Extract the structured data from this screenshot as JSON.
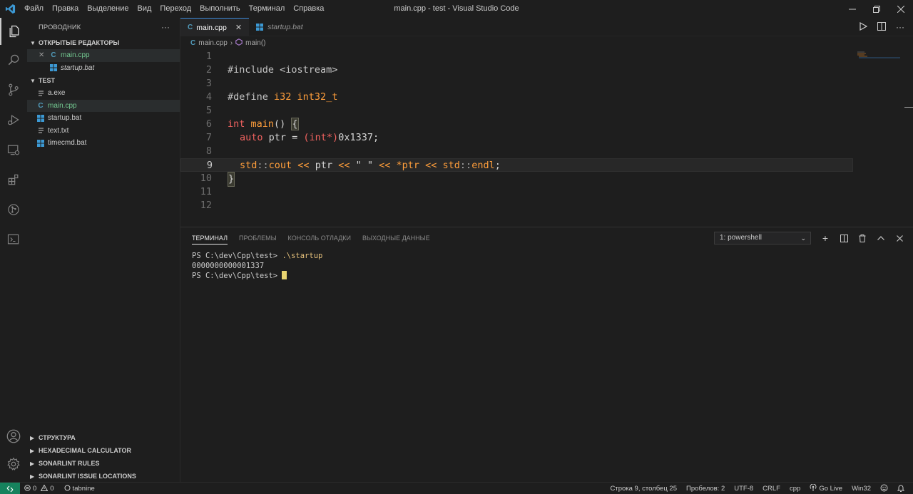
{
  "window": {
    "title": "main.cpp - test - Visual Studio Code",
    "menu": [
      "Файл",
      "Правка",
      "Выделение",
      "Вид",
      "Переход",
      "Выполнить",
      "Терминал",
      "Справка"
    ]
  },
  "activity_bar": {
    "top": [
      "explorer-icon",
      "search-icon",
      "source-control-icon",
      "run-debug-icon",
      "remote-explorer-icon",
      "extensions-icon",
      "git-graph-icon",
      "terminal-icon"
    ],
    "bottom": [
      "account-icon",
      "settings-gear-icon"
    ]
  },
  "sidebar": {
    "header": "ПРОВОДНИК",
    "more": "···",
    "open_editors": {
      "label": "ОТКРЫТЫЕ РЕДАКТОРЫ",
      "items": [
        {
          "name": "main.cpp",
          "close": "✕"
        },
        {
          "name": "startup.bat"
        }
      ]
    },
    "folder": {
      "label": "TEST",
      "items": [
        {
          "name": "a.exe"
        },
        {
          "name": "main.cpp"
        },
        {
          "name": "startup.bat"
        },
        {
          "name": "text.txt"
        },
        {
          "name": "timecmd.bat"
        }
      ]
    },
    "bottom_sections": [
      "СТРУКТУРА",
      "HEXADECIMAL CALCULATOR",
      "SONARLINT RULES",
      "SONARLINT ISSUE LOCATIONS"
    ]
  },
  "tabs": [
    {
      "label": "main.cpp",
      "close": "✕"
    },
    {
      "label": "startup.bat"
    }
  ],
  "breadcrumb": {
    "file": "main.cpp",
    "symbol": "main()"
  },
  "editor": {
    "line_numbers": [
      "1",
      "2",
      "3",
      "4",
      "5",
      "6",
      "7",
      "8",
      "9",
      "10",
      "11",
      "12"
    ],
    "lines": {
      "l2": "#include <iostream>",
      "l4": {
        "a": "#define ",
        "b": "i32",
        "c": " int32_t"
      },
      "l6": {
        "kw": "int",
        "name": " main",
        "paren": "() ",
        "brace": "{"
      },
      "l7": {
        "auto": "auto",
        "ptr": " ptr ",
        "eq": "= ",
        "cast": "(int*)",
        "num": "0x1337",
        "semi": ";"
      },
      "l9": {
        "std1": "std",
        "sep1": "::",
        "cout": "cout",
        "op1": " << ",
        "ptr": "ptr",
        "op2": " << ",
        "str": "\" \"",
        "op3": " << ",
        "deref": "*ptr",
        "op4": " << ",
        "std2": "std",
        "sep2": "::",
        "endl": "endl",
        "semi": ";"
      },
      "l10": "}"
    },
    "current_line": "9"
  },
  "panel": {
    "tabs": [
      "ТЕРМИНАЛ",
      "ПРОБЛЕМЫ",
      "КОНСОЛЬ ОТЛАДКИ",
      "ВЫХОДНЫЕ ДАННЫЕ"
    ],
    "terminal_select": "1: powershell",
    "terminal": {
      "line1_prompt": "PS C:\\dev\\Cpp\\test> ",
      "line1_cmd": ".\\startup",
      "line2": "0000000000001337",
      "line3_prompt": "PS C:\\dev\\Cpp\\test> "
    }
  },
  "statusbar": {
    "errors": "0",
    "warnings": "0",
    "tabnine": "tabnine",
    "position": "Строка 9, столбец 25",
    "spaces": "Пробелов: 2",
    "encoding": "UTF-8",
    "eol": "CRLF",
    "language": "cpp",
    "golive": "Go Live",
    "platform": "Win32"
  },
  "colors": {
    "background": "#1e1e1e",
    "accent_blue": "#3c8cdc",
    "remote_green": "#16825d",
    "keyword_red": "#f0625f",
    "orange": "#ff9e3b",
    "cpp_icon": "#519aba"
  }
}
